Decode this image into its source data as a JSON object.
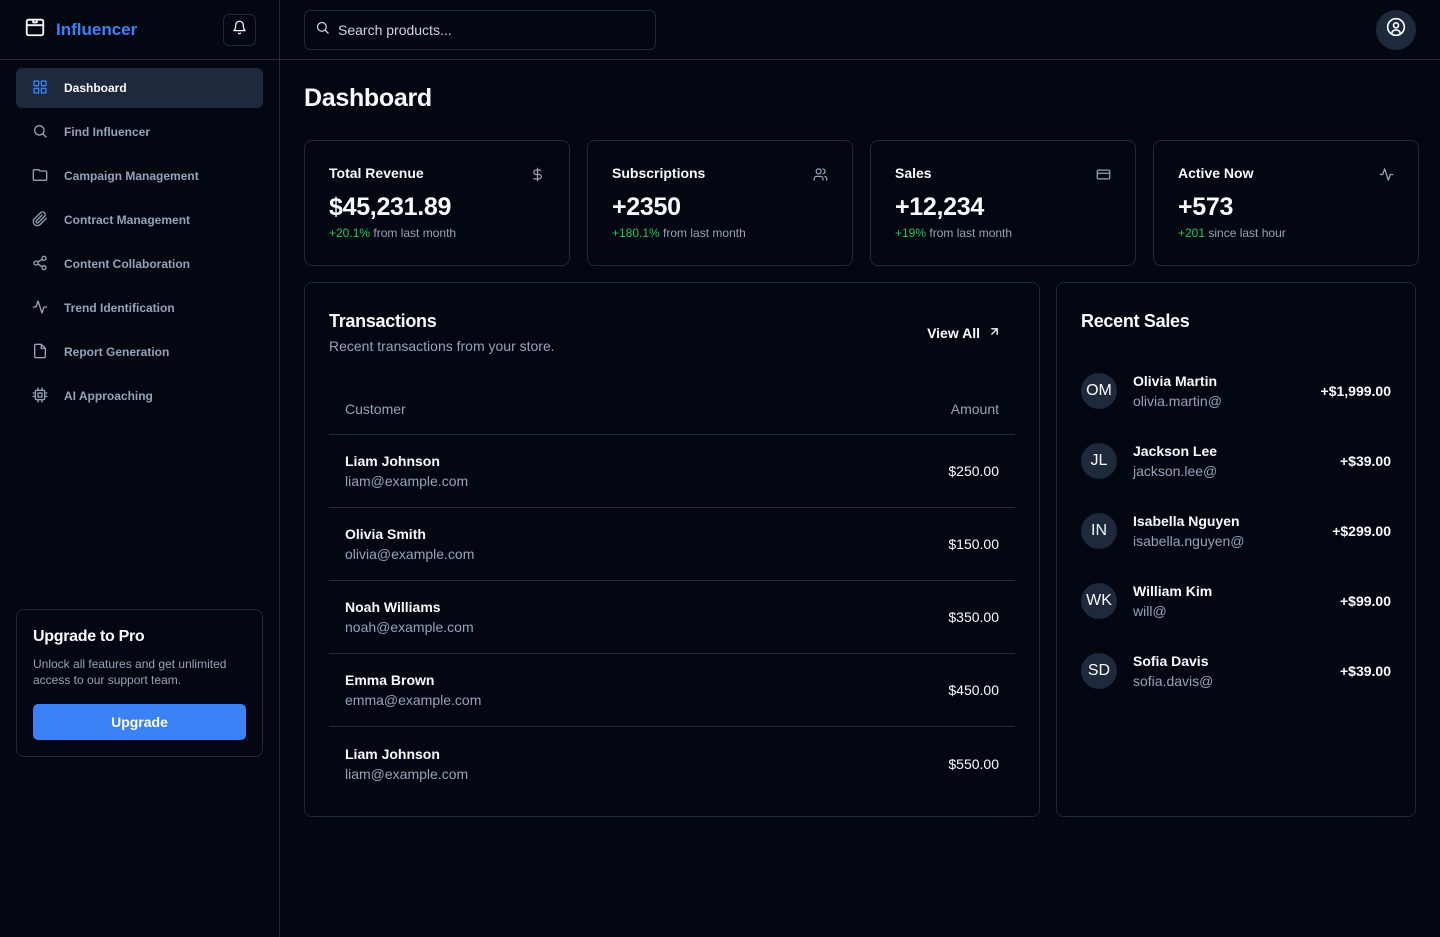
{
  "brand": {
    "name": "Influencer"
  },
  "sidebar": {
    "items": [
      {
        "label": "Dashboard",
        "icon": "grid-icon",
        "active": true
      },
      {
        "label": "Find Influencer",
        "icon": "search-icon"
      },
      {
        "label": "Campaign Management",
        "icon": "folder-icon"
      },
      {
        "label": "Contract Management",
        "icon": "paperclip-icon"
      },
      {
        "label": "Content Collaboration",
        "icon": "share-icon"
      },
      {
        "label": "Trend Identification",
        "icon": "activity-icon"
      },
      {
        "label": "Report Generation",
        "icon": "file-icon"
      },
      {
        "label": "AI Approaching",
        "icon": "cpu-icon"
      }
    ],
    "upgrade": {
      "title": "Upgrade to Pro",
      "description": "Unlock all features and get unlimited access to our support team.",
      "button": "Upgrade"
    }
  },
  "header": {
    "search_placeholder": "Search products..."
  },
  "page": {
    "title": "Dashboard"
  },
  "stats": [
    {
      "label": "Total Revenue",
      "value": "$45,231.89",
      "delta": "+20.1%",
      "suffix": " from last month",
      "icon": "dollar-icon"
    },
    {
      "label": "Subscriptions",
      "value": "+2350",
      "delta": "+180.1%",
      "suffix": " from last month",
      "icon": "users-icon"
    },
    {
      "label": "Sales",
      "value": "+12,234",
      "delta": "+19%",
      "suffix": " from last month",
      "icon": "credit-card-icon"
    },
    {
      "label": "Active Now",
      "value": "+573",
      "delta": "+201",
      "suffix": " since last hour",
      "icon": "activity-icon"
    }
  ],
  "transactions": {
    "title": "Transactions",
    "description": "Recent transactions from your store.",
    "view_all": "View All",
    "columns": {
      "customer": "Customer",
      "amount": "Amount"
    },
    "rows": [
      {
        "name": "Liam Johnson",
        "email": "liam@example.com",
        "amount": "$250.00"
      },
      {
        "name": "Olivia Smith",
        "email": "olivia@example.com",
        "amount": "$150.00"
      },
      {
        "name": "Noah Williams",
        "email": "noah@example.com",
        "amount": "$350.00"
      },
      {
        "name": "Emma Brown",
        "email": "emma@example.com",
        "amount": "$450.00"
      },
      {
        "name": "Liam Johnson",
        "email": "liam@example.com",
        "amount": "$550.00"
      }
    ]
  },
  "recent_sales": {
    "title": "Recent Sales",
    "items": [
      {
        "initials": "OM",
        "name": "Olivia Martin",
        "email": "olivia.martin@",
        "amount": "+$1,999.00"
      },
      {
        "initials": "JL",
        "name": "Jackson Lee",
        "email": "jackson.lee@",
        "amount": "+$39.00"
      },
      {
        "initials": "IN",
        "name": "Isabella Nguyen",
        "email": "isabella.nguyen@",
        "amount": "+$299.00"
      },
      {
        "initials": "WK",
        "name": "William Kim",
        "email": "will@",
        "amount": "+$99.00"
      },
      {
        "initials": "SD",
        "name": "Sofia Davis",
        "email": "sofia.davis@",
        "amount": "+$39.00"
      }
    ]
  },
  "colors": {
    "accent": "#3b82f6",
    "positive": "#22c55e",
    "background": "#030712",
    "border": "#1f2937"
  }
}
